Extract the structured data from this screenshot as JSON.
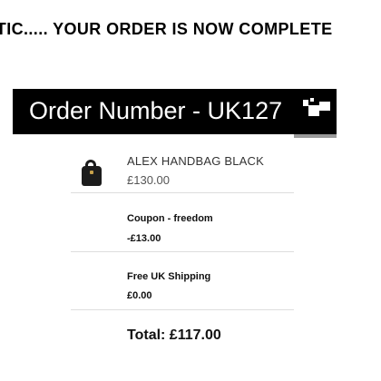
{
  "banner": {
    "text": "ASTIC..... YOUR ORDER IS NOW COMPLETE"
  },
  "order": {
    "label": "Order Number - UK127"
  },
  "item": {
    "name": "ALEX HANDBAG BLACK",
    "price": "£130.00",
    "thumbnail_icon": "handbag-icon"
  },
  "coupon": {
    "label": "Coupon - freedom",
    "value": "-£13.00"
  },
  "shipping": {
    "label": "Free UK Shipping",
    "value": "£0.00"
  },
  "total": {
    "text": "Total: £117.00"
  },
  "colors": {
    "order_bar": "#000000",
    "order_text": "#ffffff",
    "divider": "#dddddd"
  }
}
